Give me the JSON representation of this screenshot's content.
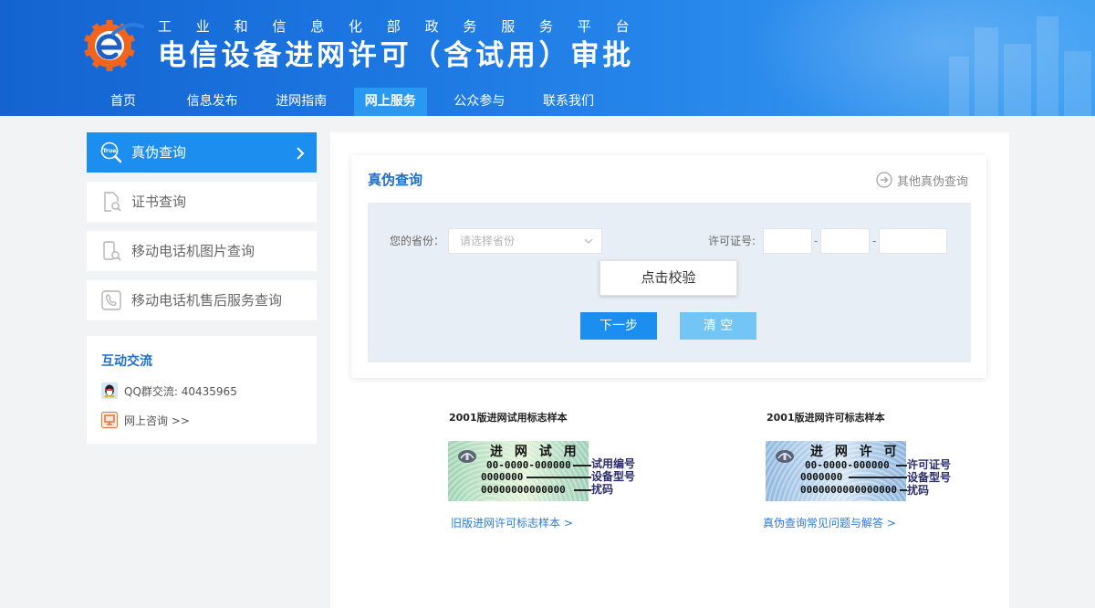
{
  "header": {
    "subtitle": "工业和信息化部政务服务平台",
    "title": "电信设备进网许可（含试用）审批",
    "logo_icon": "gear-e-logo-icon",
    "nav": [
      {
        "label": "首页",
        "active": false
      },
      {
        "label": "信息发布",
        "active": false
      },
      {
        "label": "进网指南",
        "active": false
      },
      {
        "label": "网上服务",
        "active": true
      },
      {
        "label": "公众参与",
        "active": false
      },
      {
        "label": "联系我们",
        "active": false
      }
    ]
  },
  "sidebar": {
    "items": [
      {
        "label": "真伪查询",
        "icon": "true-search-icon",
        "icon_text": "True",
        "active": true
      },
      {
        "label": "证书查询",
        "icon": "certificate-search-icon",
        "active": false
      },
      {
        "label": "移动电话机图片查询",
        "icon": "phone-search-icon",
        "active": false
      },
      {
        "label": "移动电话机售后服务查询",
        "icon": "phone-service-icon",
        "active": false
      }
    ],
    "interaction": {
      "title": "互动交流",
      "qq": "QQ群交流: 40435965",
      "qq_icon": "qq-icon",
      "online": "网上咨询 >>",
      "online_icon": "monitor-icon"
    }
  },
  "query_card": {
    "title": "真伪查询",
    "other_link": "其他真伪查询",
    "other_icon": "circle-arrow-icon",
    "form": {
      "province_label": "您的省份：",
      "province_placeholder": "请选择省份",
      "license_label": "许可证号:",
      "license_separator": "-",
      "license_values": [
        "",
        "",
        ""
      ],
      "verify_button": "点击校验",
      "next_button": "下一步",
      "clear_button": "清 空"
    }
  },
  "samples": [
    {
      "title": "2001版进网试用标志样本",
      "label": "进 网 试 用",
      "codes": [
        "00-0000-000000",
        "0000000",
        "00000000000000"
      ],
      "annotations": [
        "试用编号",
        "设备型号",
        "扰码"
      ],
      "link": "旧版进网许可标志样本 >"
    },
    {
      "title": "2001版进网许可标志样本",
      "label": "进 网 许 可",
      "codes": [
        "00-0000-000000",
        "0000000",
        "0000000000000000"
      ],
      "annotations": [
        "许可证号",
        "设备型号",
        "扰码"
      ],
      "link": "真伪查询常见问题与解答 >"
    }
  ],
  "colors": {
    "accent": "#1b8ef0",
    "title_blue": "#1f6fc5",
    "clear_button": "#72c6f6",
    "header_start": "#1463d0",
    "header_end": "#3fa0f3"
  }
}
